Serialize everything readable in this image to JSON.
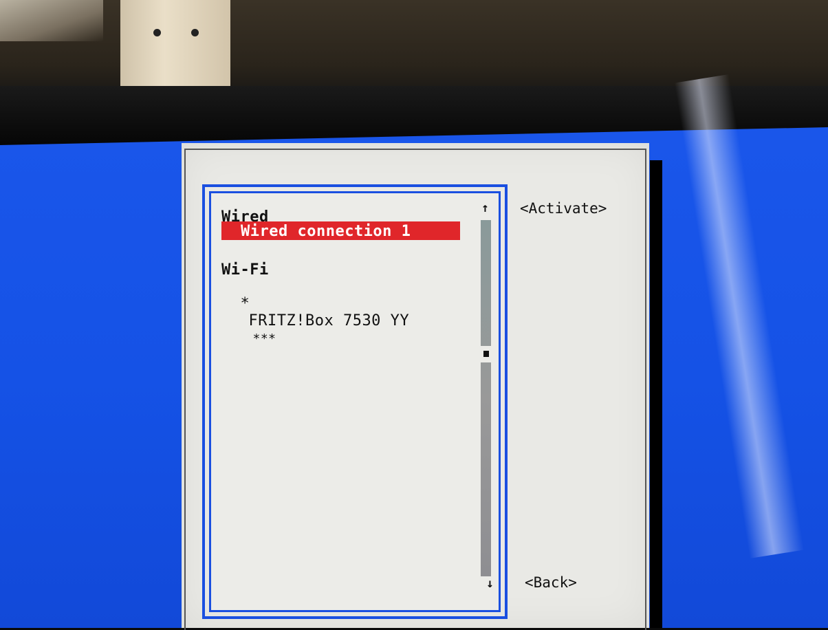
{
  "list": {
    "sections": [
      {
        "header": "Wired",
        "items": [
          "Wired connection 1"
        ]
      },
      {
        "header": "Wi-Fi",
        "items": [
          {
            "active_marker": "*",
            "ssid": "FRITZ!Box 7530 YY",
            "signal": "***"
          }
        ]
      }
    ],
    "selected_item": "Wired connection 1",
    "scroll_up_icon": "arrow-up-icon",
    "scroll_down_icon": "arrow-down-icon"
  },
  "buttons": {
    "activate": "<Activate>",
    "back": "<Back>"
  },
  "colors": {
    "screen_background": "#1552e6",
    "dialog_background": "#e9e9e5",
    "frame_border": "#1a4fe0",
    "selection_background": "#e0262a",
    "selection_text": "#ffffff"
  }
}
